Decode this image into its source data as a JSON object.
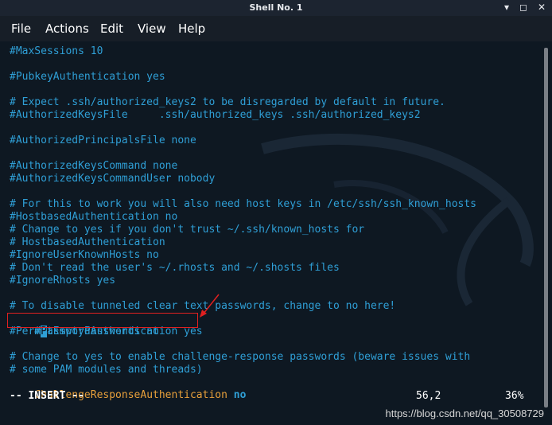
{
  "window": {
    "title": "Shell No. 1",
    "min_icon": "minimize-icon",
    "max_icon": "maximize-icon",
    "close_icon": "close-icon"
  },
  "menu": {
    "file": "File",
    "actions": "Actions",
    "edit": "Edit",
    "view": "View",
    "help": "Help"
  },
  "lines": [
    "#MaxSessions 10",
    "",
    "#PubkeyAuthentication yes",
    "",
    "# Expect .ssh/authorized_keys2 to be disregarded by default in future.",
    "#AuthorizedKeysFile     .ssh/authorized_keys .ssh/authorized_keys2",
    "",
    "#AuthorizedPrincipalsFile none",
    "",
    "#AuthorizedKeysCommand none",
    "#AuthorizedKeysCommandUser nobody",
    "",
    "# For this to work you will also need host keys in /etc/ssh/ssh_known_hosts",
    "#HostbasedAuthentication no",
    "# Change to yes if you don't trust ~/.ssh/known_hosts for",
    "# HostbasedAuthentication",
    "#IgnoreUserKnownHosts no",
    "# Don't read the user's ~/.rhosts and ~/.shosts files",
    "#IgnoreRhosts yes",
    "",
    "# To disable tunneled clear text passwords, change to no here!",
    "#PasswordAuthentication yes",
    "#PermitEmptyPasswords no",
    "",
    "# Change to yes to enable challenge-response passwords (beware issues with",
    "# some PAM modules and threads)"
  ],
  "cursor_line": {
    "prefix": "#",
    "cursor_char": "P",
    "suffix": "asswordAuthentication yes"
  },
  "last_line": {
    "key": "ChallengeResponseAuthentication",
    "value": "no"
  },
  "status": {
    "mode": "-- INSERT --",
    "position": "56,2",
    "percent": "36%"
  },
  "watermark": "https://blog.csdn.net/qq_30508729",
  "colors": {
    "text": "#2f9fd6",
    "orange": "#e8a03b",
    "highlight_box": "#e02020",
    "background": "#0e1822"
  }
}
